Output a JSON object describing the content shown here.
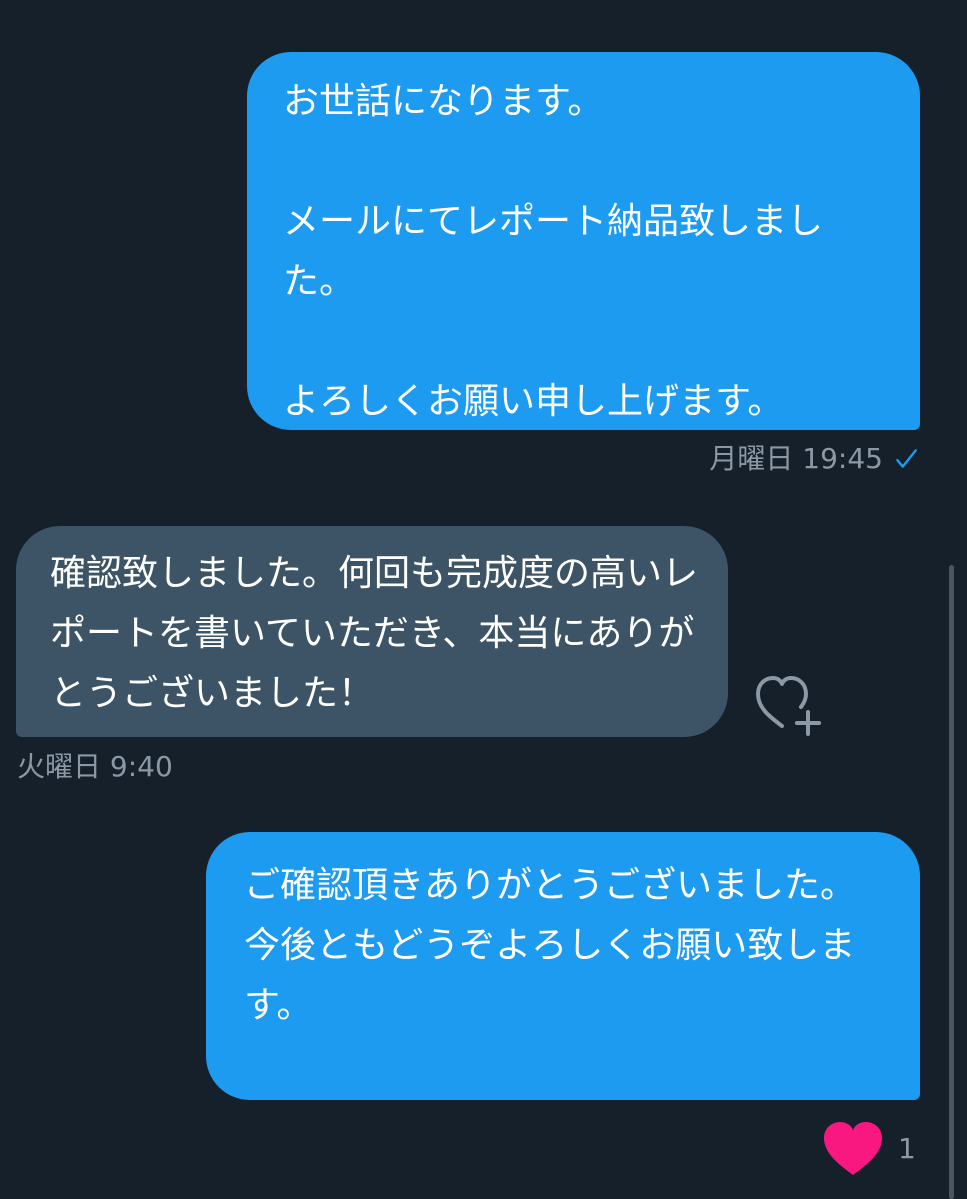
{
  "messages": [
    {
      "direction": "sent",
      "text": "お世話になります。\n\nメールにてレポート納品致しました。\n\nよろしくお願い申し上げます。",
      "time": "月曜日 19:45",
      "read_icon": "checkmark-icon"
    },
    {
      "direction": "received",
      "text": "確認致しました。何回も完成度の高いレポートを書いていただき、本当にありがとうございました！",
      "time": "火曜日 9:40",
      "react_icon": "add-reaction-heart-icon"
    },
    {
      "direction": "sent",
      "text": "ご確認頂きありがとうございました。\n今後ともどうぞよろしくお願い致します。",
      "reaction": {
        "icon": "heart-icon",
        "count": "1"
      }
    }
  ],
  "colors": {
    "background": "#15202b",
    "sent_bubble": "#1d9bf0",
    "received_bubble": "#3d5466",
    "meta_text": "#8b98a5",
    "reaction_heart": "#f91880"
  }
}
